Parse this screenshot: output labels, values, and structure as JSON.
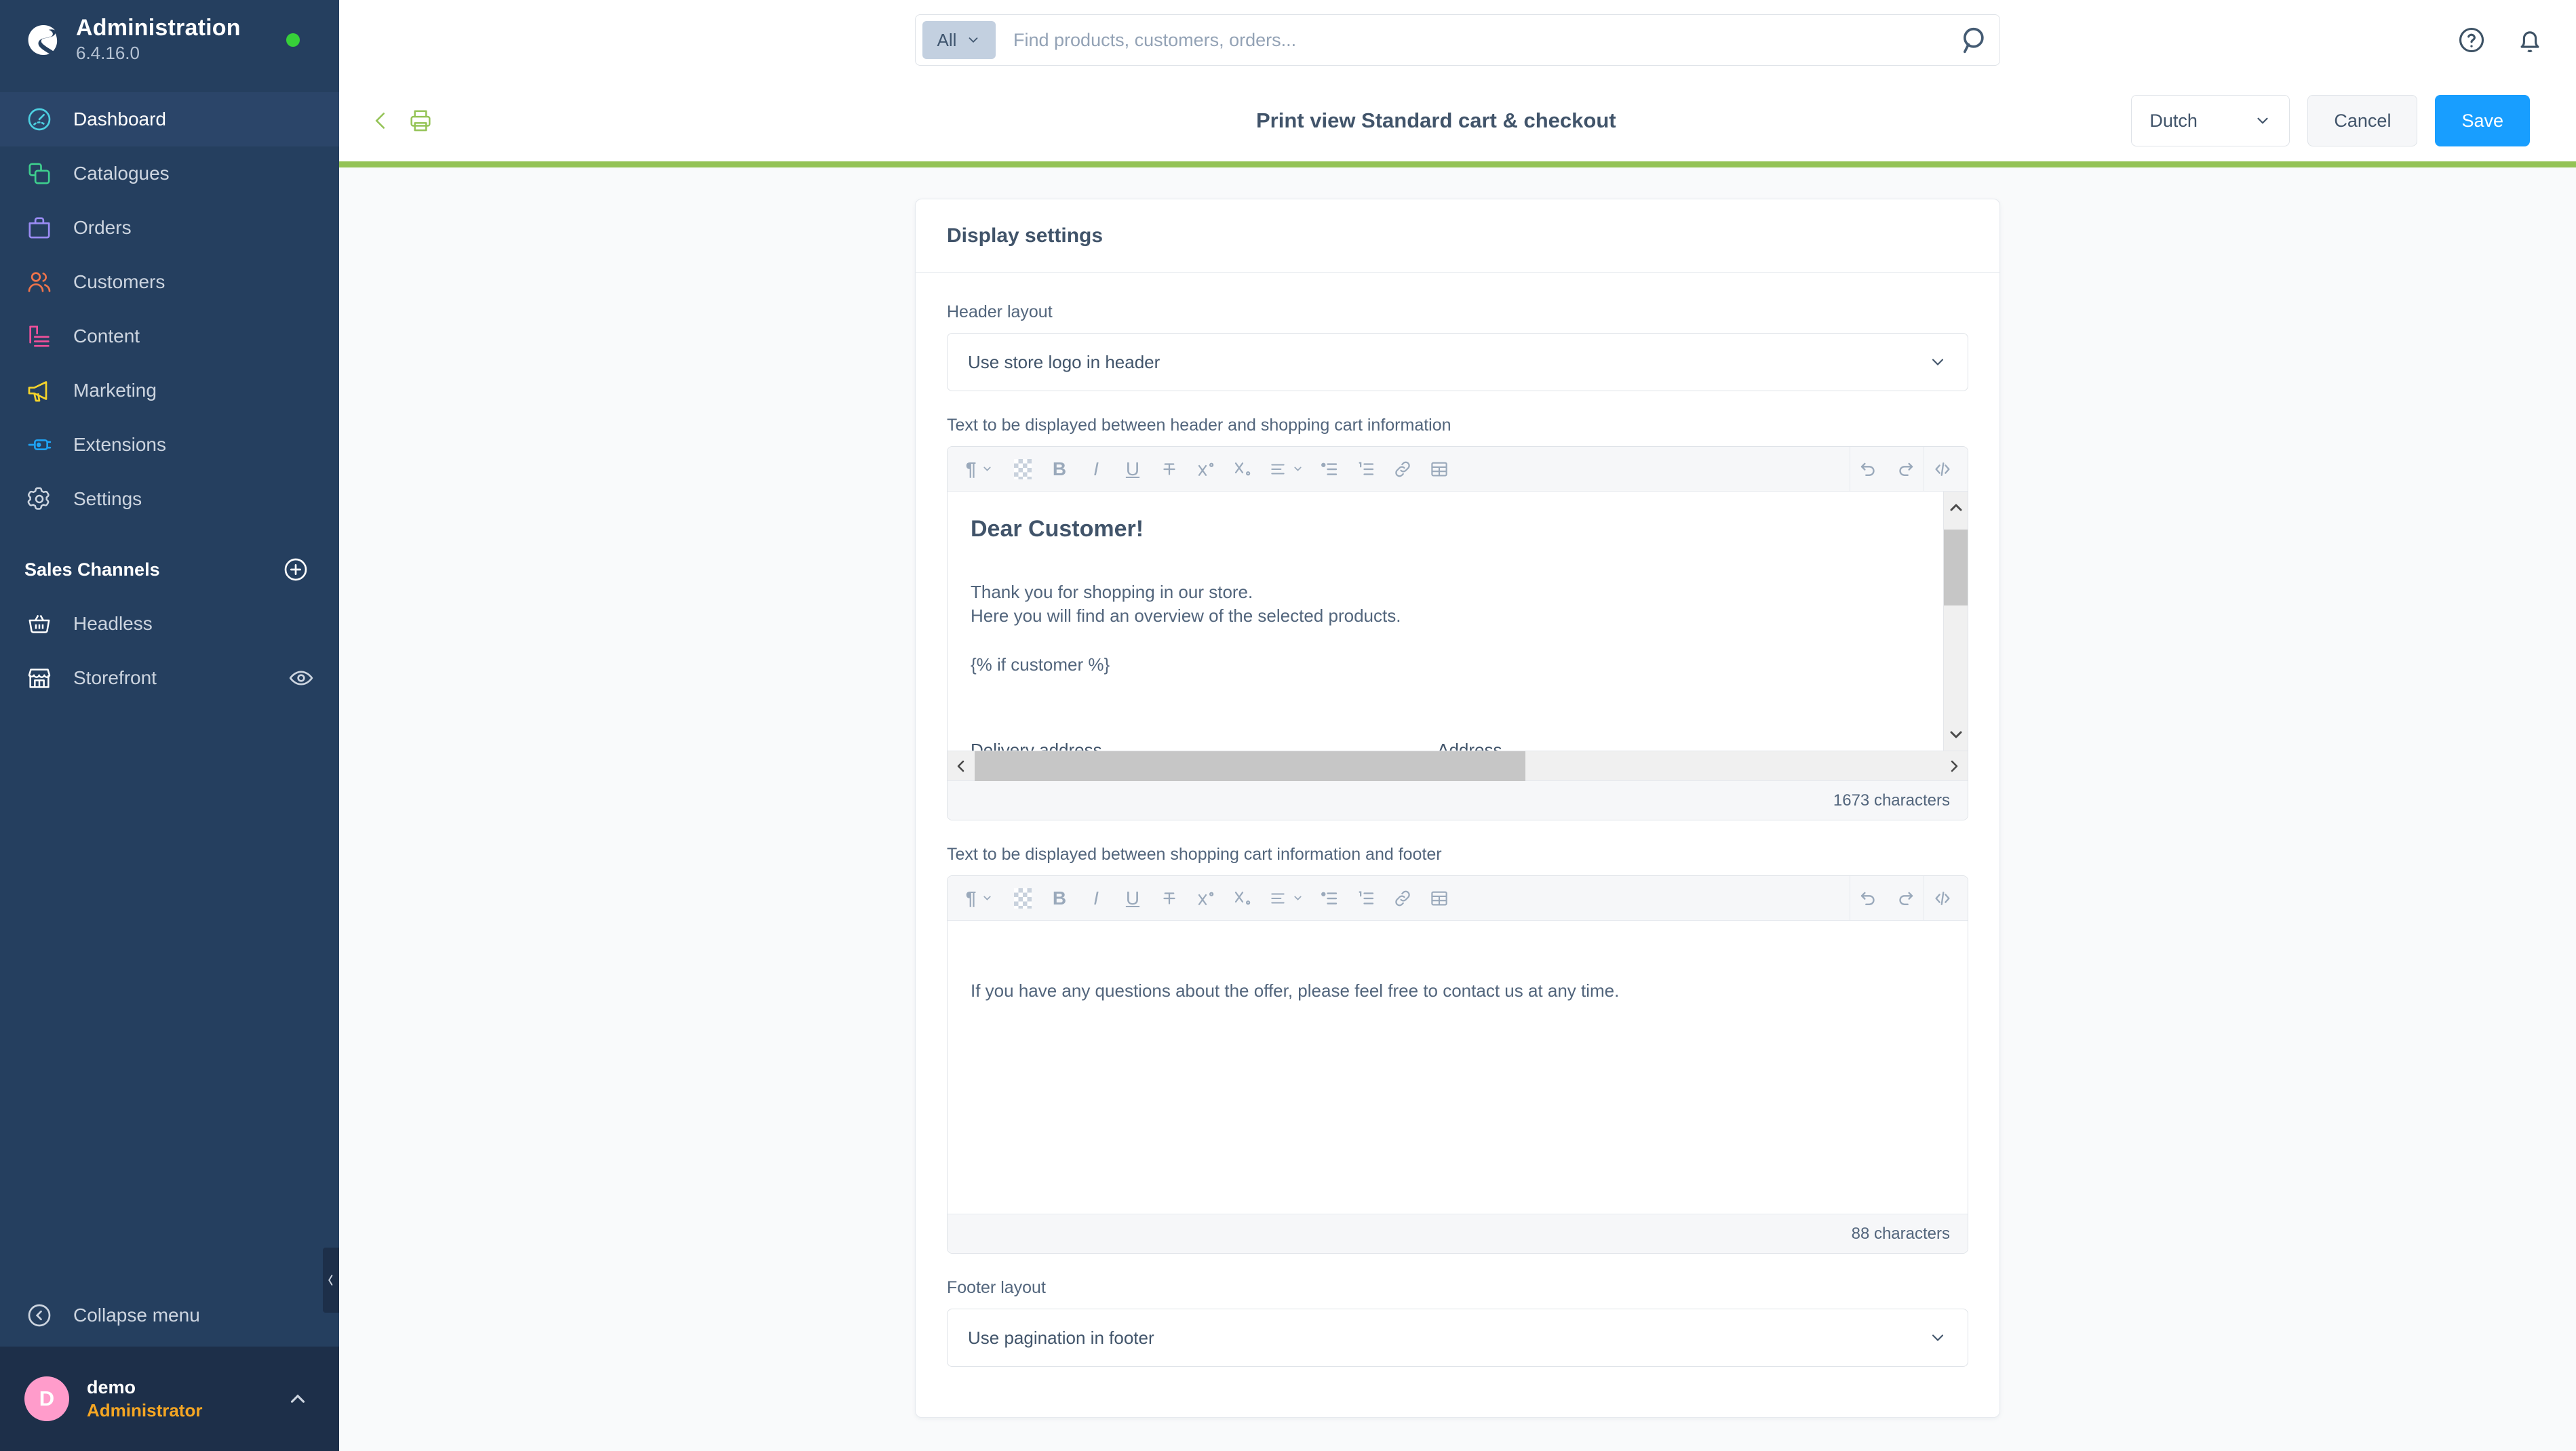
{
  "sidebar": {
    "brand": {
      "title": "Administration",
      "version": "6.4.16.0",
      "status_color": "#37d039"
    },
    "items": [
      {
        "label": "Dashboard",
        "icon": "dashboard-icon",
        "active": true
      },
      {
        "label": "Catalogues",
        "icon": "catalogues-icon",
        "active": false
      },
      {
        "label": "Orders",
        "icon": "orders-icon",
        "active": false
      },
      {
        "label": "Customers",
        "icon": "customers-icon",
        "active": false
      },
      {
        "label": "Content",
        "icon": "content-icon",
        "active": false
      },
      {
        "label": "Marketing",
        "icon": "marketing-icon",
        "active": false
      },
      {
        "label": "Extensions",
        "icon": "extensions-icon",
        "active": false
      },
      {
        "label": "Settings",
        "icon": "settings-icon",
        "active": false
      }
    ],
    "sales_channels": {
      "label": "Sales Channels",
      "add_icon": "plus-circle-icon",
      "channels": [
        {
          "label": "Headless",
          "icon": "basket-icon"
        },
        {
          "label": "Storefront",
          "icon": "store-icon",
          "trailing_icon": "eye-icon"
        }
      ]
    },
    "collapse": {
      "label": "Collapse menu",
      "icon": "collapse-left-icon"
    },
    "user": {
      "initial": "D",
      "name": "demo",
      "role": "Administrator",
      "caret": "chevron-up-icon"
    }
  },
  "topbar": {
    "scope_label": "All",
    "search_placeholder": "Find products, customers, orders...",
    "search_value": "",
    "search_icon": "search-icon",
    "help_icon": "help-circle-icon",
    "notification_icon": "bell-icon"
  },
  "pagehead": {
    "back_icon": "chevron-left-icon",
    "print_icon": "printer-icon",
    "title": "Print view Standard cart & checkout",
    "language": "Dutch",
    "language_caret": "chevron-down-icon",
    "cancel_label": "Cancel",
    "save_label": "Save",
    "accent_color": "#94c356",
    "save_color": "#189eff"
  },
  "card": {
    "title": "Display settings",
    "header_layout": {
      "label": "Header layout",
      "value": "Use store logo in header",
      "caret": "chevron-down-icon"
    },
    "editor_top": {
      "label": "Text to be displayed between header and shopping cart information",
      "heading": "Dear Customer!",
      "line1": "Thank you for shopping in our store.",
      "line2": "Here you will find an overview of the selected products.",
      "line3": "{% if customer %}",
      "clipped_left": "Delivery address",
      "clipped_right": "Address",
      "char_count": "1673 characters"
    },
    "editor_bottom": {
      "label": "Text to be displayed between shopping cart information and footer",
      "line1": "If you have any questions about the offer, please feel free to contact us at any time.",
      "char_count": "88 characters"
    },
    "footer_layout": {
      "label": "Footer layout",
      "value": "Use pagination in footer",
      "caret": "chevron-down-icon"
    },
    "toolbar_icons": [
      {
        "name": "paragraph-format-icon",
        "glyph": "¶",
        "caret": true
      },
      {
        "name": "text-color-icon",
        "glyph": "",
        "caret": false
      },
      {
        "name": "bold-icon",
        "glyph": "B",
        "caret": false
      },
      {
        "name": "italic-icon",
        "glyph": "I",
        "caret": false
      },
      {
        "name": "underline-icon",
        "glyph": "U",
        "caret": false
      },
      {
        "name": "strikethrough-icon",
        "glyph": "T",
        "caret": false
      },
      {
        "name": "superscript-icon",
        "glyph": "X",
        "caret": false
      },
      {
        "name": "subscript-icon",
        "glyph": "X",
        "caret": false
      },
      {
        "name": "align-icon",
        "glyph": "",
        "caret": true
      },
      {
        "name": "bullet-list-icon",
        "glyph": "",
        "caret": false
      },
      {
        "name": "ordered-list-icon",
        "glyph": "",
        "caret": false
      },
      {
        "name": "link-icon",
        "glyph": "",
        "caret": false
      },
      {
        "name": "table-icon",
        "glyph": "",
        "caret": false
      }
    ],
    "toolbar_right_icons": [
      {
        "name": "undo-icon"
      },
      {
        "name": "redo-icon"
      },
      {
        "name": "code-view-icon"
      }
    ]
  }
}
